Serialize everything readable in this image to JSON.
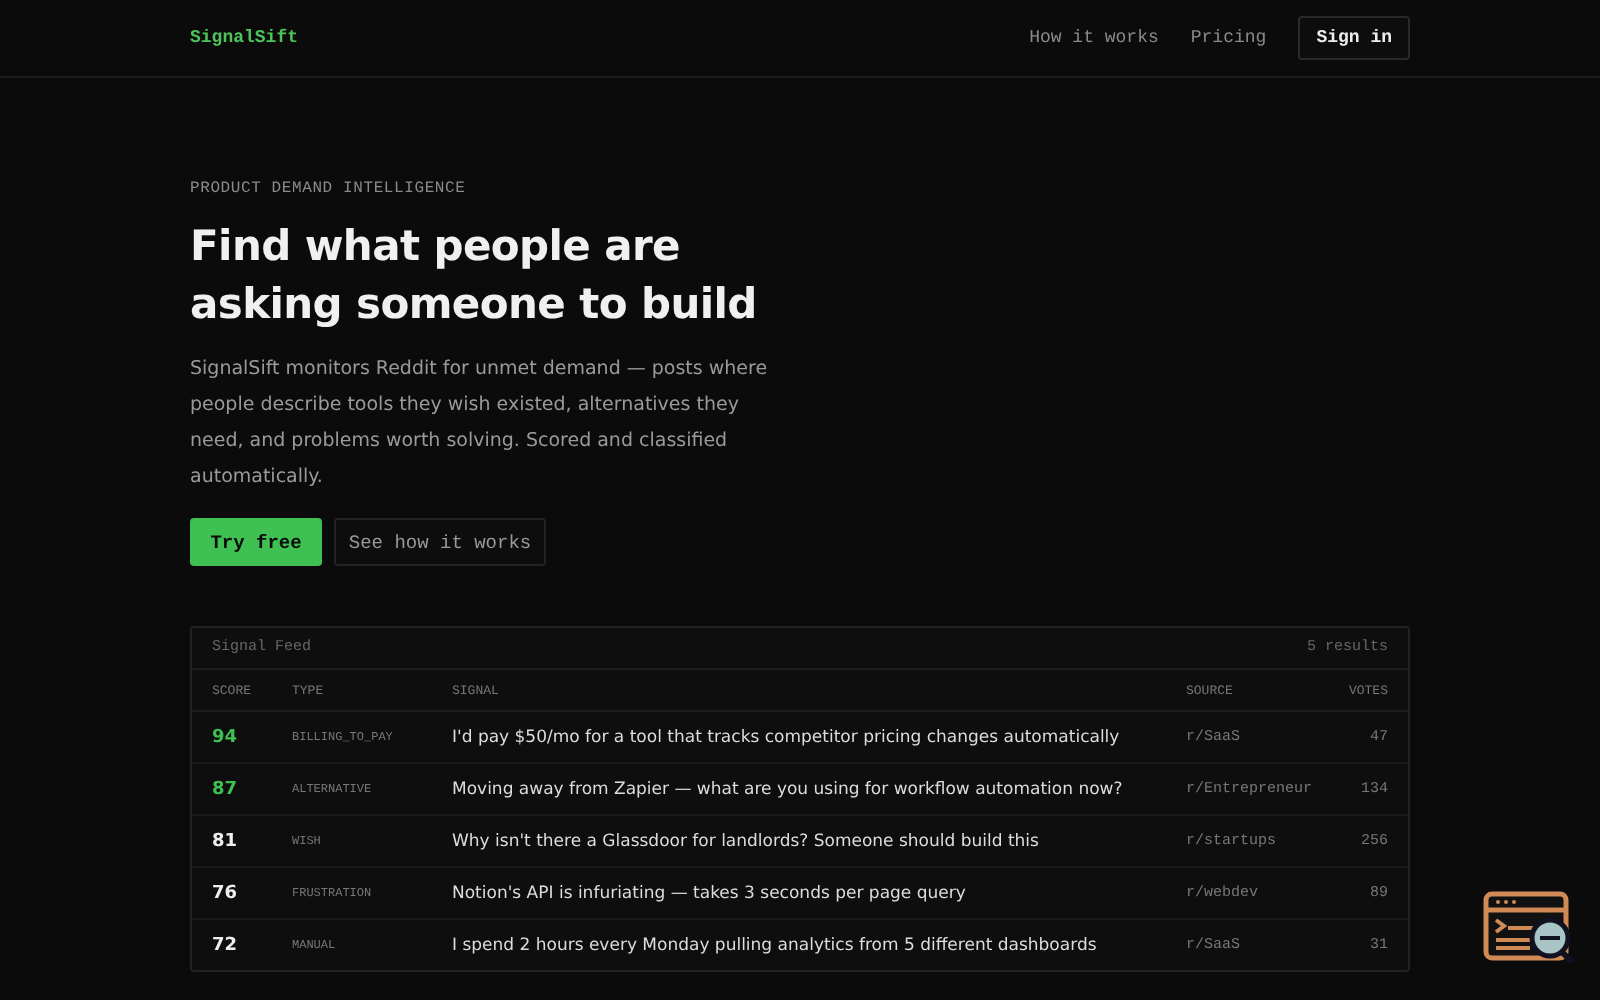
{
  "nav": {
    "brand": "SignalSift",
    "links": [
      "How it works",
      "Pricing"
    ],
    "sign_in": "Sign in"
  },
  "hero": {
    "eyebrow": "PRODUCT DEMAND INTELLIGENCE",
    "title": "Find what people are asking someone to build",
    "description": "SignalSift monitors Reddit for unmet demand — posts where people describe tools they wish existed, alternatives they need, and problems worth solving. Scored and classified automatically.",
    "primary_button": "Try free",
    "secondary_button": "See how it works"
  },
  "feed": {
    "title": "Signal Feed",
    "count": "5 results",
    "columns": [
      "SCORE",
      "TYPE",
      "SIGNAL",
      "SOURCE",
      "VOTES"
    ],
    "rows": [
      {
        "score": "94",
        "high": true,
        "type": "BILLING_TO_PAY",
        "signal": "I'd pay $50/mo for a tool that tracks competitor pricing changes automatically",
        "source": "r/SaaS",
        "votes": "47"
      },
      {
        "score": "87",
        "high": true,
        "type": "ALTERNATIVE",
        "signal": "Moving away from Zapier — what are you using for workflow automation now?",
        "source": "r/Entrepreneur",
        "votes": "134"
      },
      {
        "score": "81",
        "high": false,
        "type": "WISH",
        "signal": "Why isn't there a Glassdoor for landlords? Someone should build this",
        "source": "r/startups",
        "votes": "256"
      },
      {
        "score": "76",
        "high": false,
        "type": "FRUSTRATION",
        "signal": "Notion's API is infuriating — takes 3 seconds per page query",
        "source": "r/webdev",
        "votes": "89"
      },
      {
        "score": "72",
        "high": false,
        "type": "MANUAL",
        "signal": "I spend 2 hours every Monday pulling analytics from 5 different dashboards",
        "source": "r/SaaS",
        "votes": "31"
      }
    ]
  }
}
